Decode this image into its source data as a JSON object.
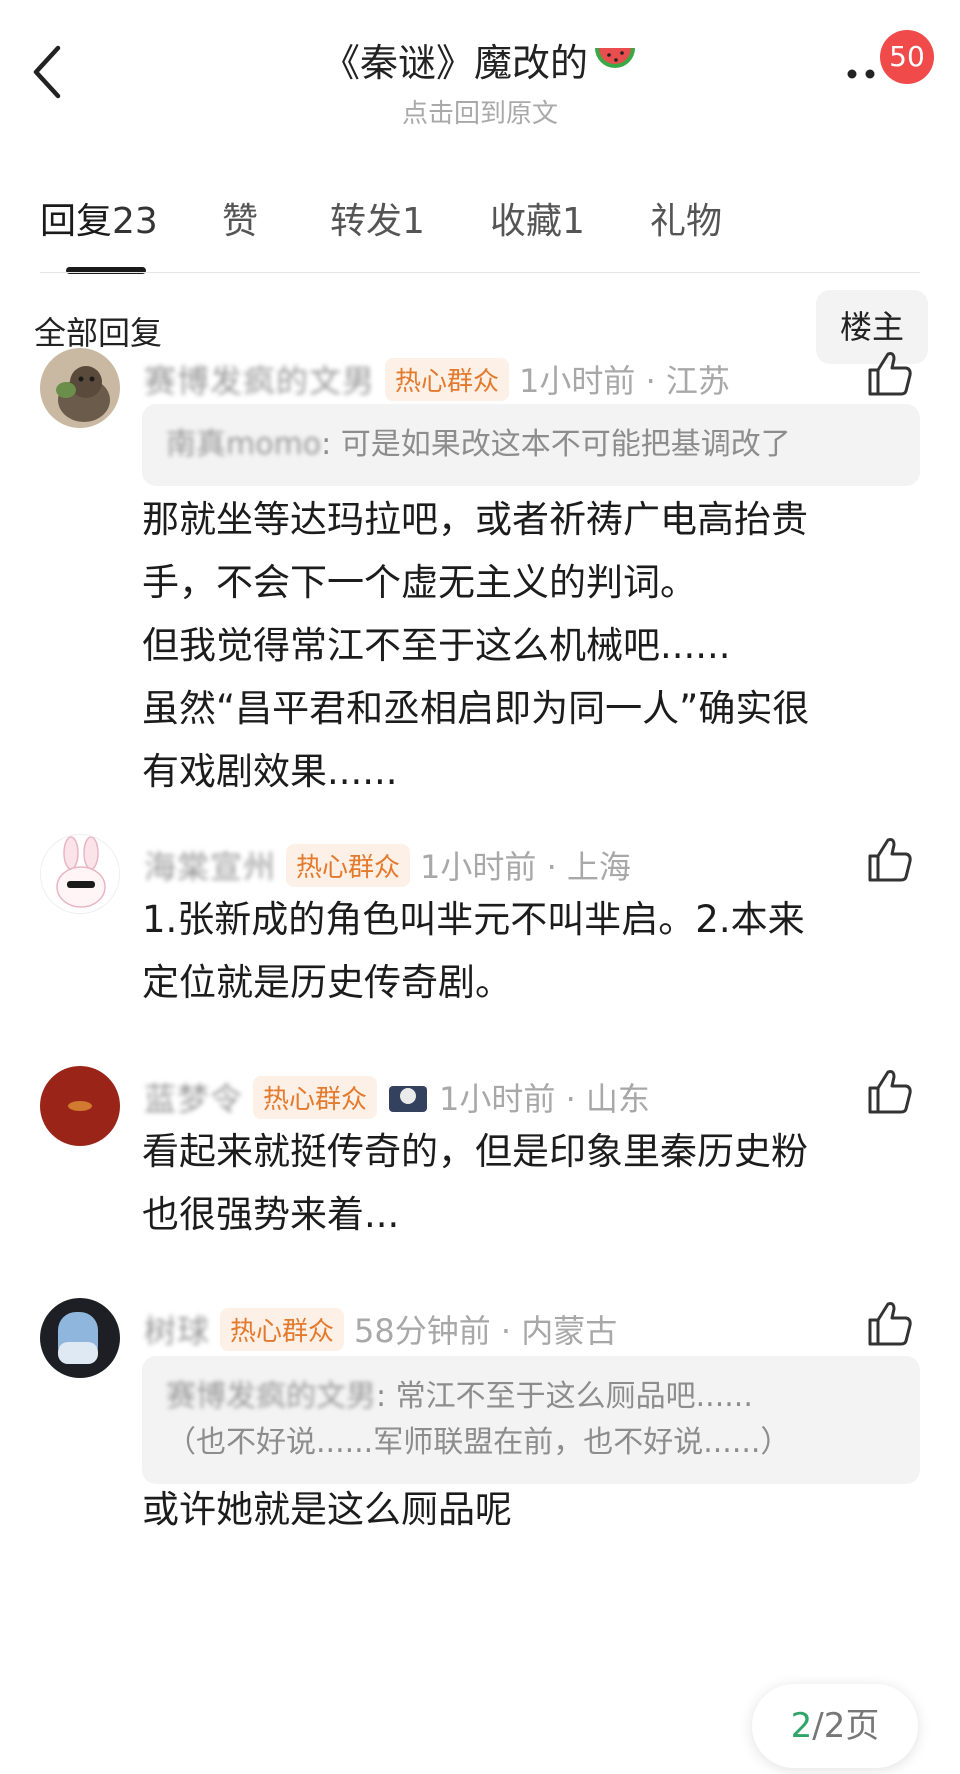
{
  "header": {
    "title": "《秦谜》魔改的",
    "subtitle": "点击回到原文",
    "notification_count": "50"
  },
  "tabs": [
    {
      "label": "回复",
      "count": "23"
    },
    {
      "label": "赞",
      "count": ""
    },
    {
      "label": "转发",
      "count": "1"
    },
    {
      "label": "收藏",
      "count": "1"
    },
    {
      "label": "礼物",
      "count": ""
    }
  ],
  "filter": {
    "label": "全部回复",
    "owner_button": "楼主"
  },
  "comments": [
    {
      "name": "赛博发疯的文男",
      "tag": "热心群众",
      "time": "1小时前 · 江苏",
      "quote_name": "南真momo",
      "quote_text": ": 可是如果改这本不可能把基调改了",
      "body": "那就坐等达玛拉吧，或者祈祷广电高抬贵\n手，不会下一个虚无主义的判词。\n但我觉得常江不至于这么机械吧......\n虽然“昌平君和丞相启即为同一人”确实很\n有戏剧效果......"
    },
    {
      "name": "海棠宣州",
      "tag": "热心群众",
      "time": "1小时前 · 上海",
      "body": "1.张新成的角色叫芈元不叫芈启。2.本来\n定位就是历史传奇剧。"
    },
    {
      "name": "蓝梦令",
      "tag": "热心群众",
      "time": "1小时前 · 山东",
      "body": "看起来就挺传奇的，但是印象里秦历史粉\n也很强势来着..."
    },
    {
      "name": "树球",
      "tag": "热心群众",
      "time": "58分钟前 · 内蒙古",
      "quote_name": "赛博发疯的文男",
      "quote_text": ": 常江不至于这么厕品吧......\n（也不好说......军师联盟在前，也不好说......）",
      "body": "或许她就是这么厕品呢"
    }
  ],
  "pager": {
    "current": "2",
    "total": "/2页"
  },
  "colors": {
    "accent_green": "#2fa56a",
    "badge_red": "#f04a4a",
    "tag_orange": "#e37b2f"
  }
}
